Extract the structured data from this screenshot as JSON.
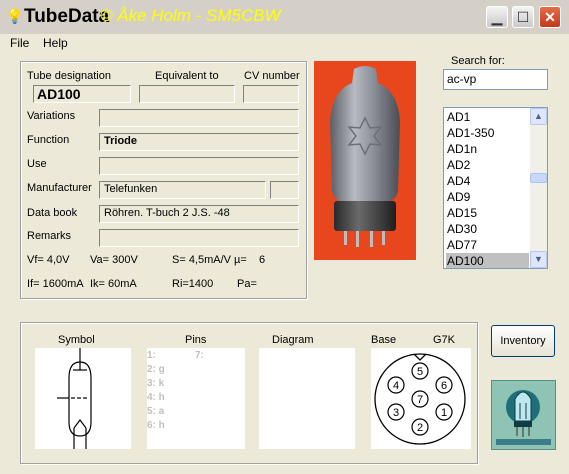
{
  "window": {
    "title": "TubeData",
    "credit": "© Åke Holm - SM5CBW",
    "controls": [
      "minimize",
      "maximize",
      "close"
    ]
  },
  "menu": {
    "file": "File",
    "help": "Help"
  },
  "form": {
    "tube_designation_label": "Tube designation",
    "equivalent_label": "Equivalent to",
    "cv_label": "CV number",
    "tube_designation": "AD100",
    "equivalent": "",
    "cv_number": "",
    "variations_label": "Variations",
    "variations": "",
    "function_label": "Function",
    "function": "Triode",
    "use_label": "Use",
    "use": "",
    "manufacturer_label": "Manufacturer",
    "manufacturer": "Telefunken",
    "manufacturer_extra": "",
    "databook_label": "Data book",
    "databook": "Röhren. T-buch 2 J.S. -48",
    "remarks_label": "Remarks",
    "remarks": "",
    "params_row1": {
      "vf": "Vf= 4,0V",
      "va": "Va= 300V",
      "s": "S= 4,5mA/V",
      "mu": "µ=",
      "mu_val": "6"
    },
    "params_row2": {
      "if": "If= 1600mA",
      "ik": "Ik= 60mA",
      "ri": "Ri=1400",
      "pa": "Pa="
    }
  },
  "search": {
    "label": "Search for:",
    "value": "ac-vp",
    "items": [
      "AD1",
      "AD1-350",
      "AD1n",
      "AD2",
      "AD4",
      "AD9",
      "AD15",
      "AD30",
      "AD77",
      "AD100"
    ],
    "selected_index": 9
  },
  "bottom": {
    "symbol_label": "Symbol",
    "pins_label": "Pins",
    "diagram_label": "Diagram",
    "base_label": "Base",
    "base_type": "G7K",
    "pins": [
      "1:",
      "2: g",
      "3: k",
      "4: h",
      "5: a",
      "6: h",
      "7:"
    ],
    "base_pins": [
      "1",
      "2",
      "3",
      "4",
      "5",
      "6",
      "7"
    ],
    "inventory_button": "Inventory"
  },
  "colors": {
    "photo_bg": "#e8471e",
    "title_credit": "#ffff00",
    "selected_item": "#c0c0c0"
  }
}
